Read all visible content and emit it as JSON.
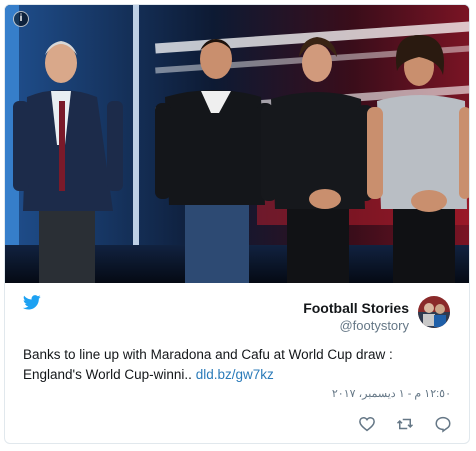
{
  "tweet": {
    "author_name": "Football Stories",
    "author_handle": "@footystory",
    "text": "Banks to line up with Maradona and Cafu at World Cup draw : England's World Cup-winni..",
    "link_text": "dld.bz/gw7kz",
    "timestamp": "١٢:٥٠ م - ١ ديسمبر، ٢٠١٧"
  },
  "icons": {
    "info": "info-icon",
    "brand": "twitter-bird-icon",
    "like": "heart-icon",
    "retweet": "retweet-icon",
    "reply": "reply-icon"
  },
  "info_glyph": "i",
  "colors": {
    "brand_blue": "#1da1f2",
    "link": "#2b7bb9",
    "text": "#14171a",
    "muted": "#657786",
    "border": "#e1e8ed"
  }
}
